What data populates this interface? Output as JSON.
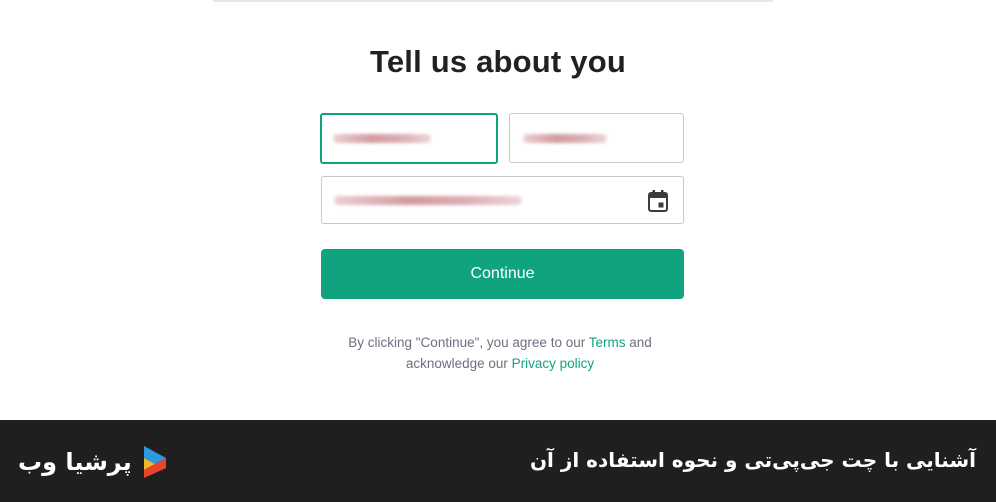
{
  "form": {
    "title": "Tell us about you",
    "continue_label": "Continue",
    "legal": {
      "prefix": "By clicking \"Continue\", you agree to our ",
      "terms_link": "Terms",
      "middle": " and",
      "line2_prefix": "acknowledge our ",
      "privacy_link": "Privacy policy"
    },
    "accent_color": "#10a37f"
  },
  "footer": {
    "caption": "آشنایی با چت جی‌پی‌تی و نحوه استفاده از آن",
    "brand_name": "پرشیا وب",
    "background": "#1f1f1f"
  },
  "icons": {
    "date_picker": "calendar-icon",
    "brand": "persiaweb-logo-icon"
  }
}
